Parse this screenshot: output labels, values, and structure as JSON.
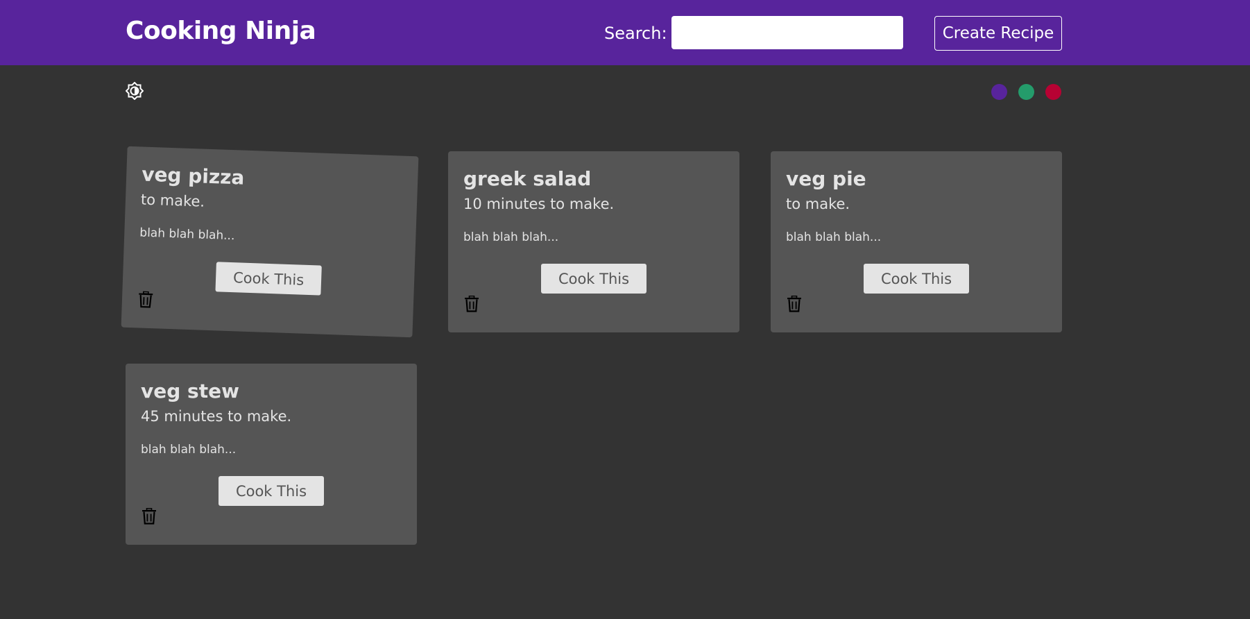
{
  "navbar": {
    "brand": "Cooking Ninja",
    "search_label": "Search:",
    "search_value": "",
    "create_label": "Create Recipe",
    "background": "#58249c"
  },
  "theme": {
    "mode_icon": "brightness-icon",
    "swatches": [
      {
        "name": "purple",
        "color": "#58249c"
      },
      {
        "name": "green",
        "color": "#249c6b"
      },
      {
        "name": "red",
        "color": "#b70233"
      }
    ]
  },
  "recipes": [
    {
      "title": "veg pizza",
      "time": "to make.",
      "description": "blah blah blah...",
      "action": "Cook This",
      "delete_icon": "trash-icon"
    },
    {
      "title": "greek salad",
      "time": "10 minutes to make.",
      "description": "blah blah blah...",
      "action": "Cook This",
      "delete_icon": "trash-icon"
    },
    {
      "title": "veg pie",
      "time": "to make.",
      "description": "blah blah blah...",
      "action": "Cook This",
      "delete_icon": "trash-icon"
    },
    {
      "title": "veg stew",
      "time": "45 minutes to make.",
      "description": "blah blah blah...",
      "action": "Cook This",
      "delete_icon": "trash-icon"
    }
  ]
}
